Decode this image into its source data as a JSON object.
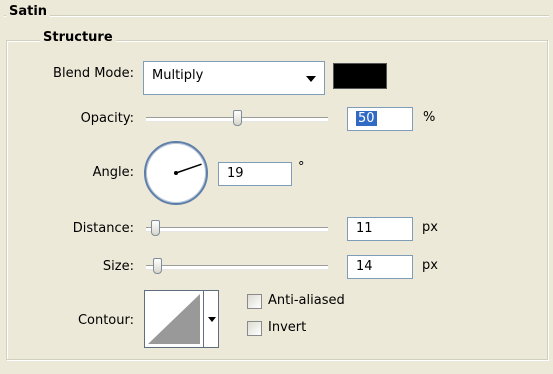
{
  "sections": {
    "satin_title": "Satin",
    "structure_title": "Structure"
  },
  "blend_mode": {
    "label": "Blend Mode:",
    "value": "Multiply",
    "color": "#000000"
  },
  "opacity": {
    "label": "Opacity:",
    "value": "50",
    "unit": "%",
    "level": 0.5
  },
  "angle": {
    "label": "Angle:",
    "value": "19",
    "unit": "°"
  },
  "distance": {
    "label": "Distance:",
    "value": "11",
    "unit": "px",
    "level": 0.05
  },
  "size": {
    "label": "Size:",
    "value": "14",
    "unit": "px",
    "level": 0.06
  },
  "contour": {
    "label": "Contour:",
    "anti_aliased_label": "Anti-aliased",
    "anti_aliased_checked": false,
    "invert_label": "Invert",
    "invert_checked": false
  }
}
